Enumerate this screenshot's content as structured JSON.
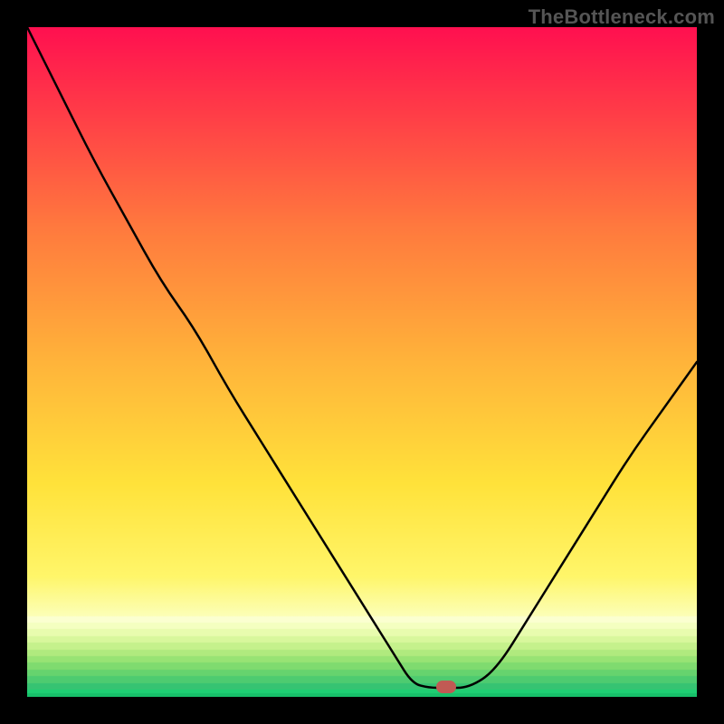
{
  "watermark": {
    "text": "TheBottleneck.com"
  },
  "marker": {
    "color": "#c15a54",
    "x_frac": 0.625,
    "y_frac": 0.985
  },
  "chart_data": {
    "type": "line",
    "title": "",
    "xlabel": "",
    "ylabel": "",
    "x": [
      0.0,
      0.05,
      0.1,
      0.15,
      0.2,
      0.25,
      0.3,
      0.35,
      0.4,
      0.45,
      0.5,
      0.55,
      0.575,
      0.6,
      0.625,
      0.66,
      0.7,
      0.75,
      0.8,
      0.85,
      0.9,
      0.95,
      1.0
    ],
    "values": [
      1.0,
      0.9,
      0.8,
      0.71,
      0.62,
      0.55,
      0.46,
      0.38,
      0.3,
      0.22,
      0.14,
      0.06,
      0.02,
      0.0,
      0.0,
      0.0,
      0.04,
      0.12,
      0.2,
      0.28,
      0.36,
      0.43,
      0.5
    ],
    "ylim": [
      0,
      1
    ],
    "xlim": [
      0,
      1
    ],
    "note": "x and y are normalized fractions of the plot area; y=0 is bottom (green), y=1 is top (red). The curve is a V-shaped bottleneck dip reaching y≈0 around x≈0.60–0.66 and rising to ~0.5 at x=1.",
    "background_gradient": {
      "direction": "vertical",
      "stops": [
        {
          "pos": 0.0,
          "color": "#ff1744"
        },
        {
          "pos": 0.25,
          "color": "#ff6a3c"
        },
        {
          "pos": 0.5,
          "color": "#ffb43a"
        },
        {
          "pos": 0.7,
          "color": "#ffe23a"
        },
        {
          "pos": 0.86,
          "color": "#fff8b0"
        },
        {
          "pos": 0.92,
          "color": "#d8f7a0"
        },
        {
          "pos": 0.96,
          "color": "#7be07b"
        },
        {
          "pos": 1.0,
          "color": "#1ecf73"
        }
      ]
    },
    "marker": {
      "x": 0.625,
      "y": 0.015,
      "color": "#c15a54",
      "shape": "pill"
    }
  }
}
